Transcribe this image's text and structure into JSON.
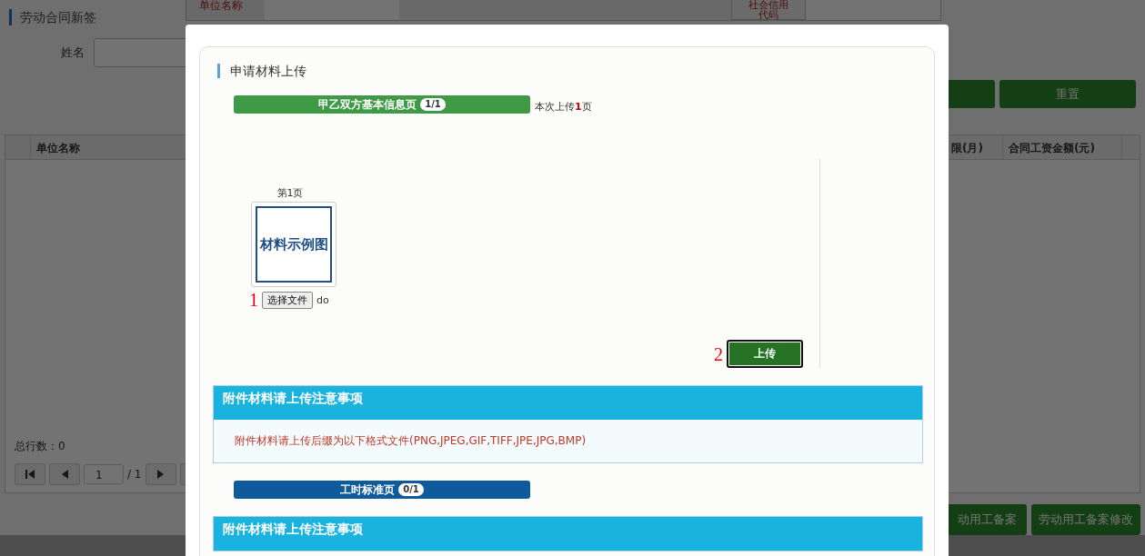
{
  "page": {
    "title": "劳动合同新签",
    "name_label": "姓名",
    "reset_button": "重置",
    "table": {
      "columns": [
        "单位名称",
        "限(月)",
        "合同工资金额(元)"
      ]
    },
    "total_rows": "总行数：0",
    "pager": {
      "page": "1",
      "total": "/ 1"
    },
    "bottom_buttons": [
      "动用工备案",
      "劳动用工备案修改"
    ]
  },
  "back_form": {
    "fields": [
      {
        "label": "单位名称"
      },
      {
        "label": "社会信用代码"
      }
    ]
  },
  "modal": {
    "title": "申请材料上传",
    "groups": [
      {
        "label": "甲乙双方基本信息页",
        "badge": "1/1",
        "color": "#3f9a45",
        "note": {
          "prefix": "本次上传",
          "count": "1",
          "suffix": "页"
        },
        "upload": {
          "page_label": "第1页",
          "example": "材料示例图",
          "step_1": "1",
          "file_button": "选择文件",
          "file_name": "do",
          "step_2": "2",
          "upload_button": "上传"
        },
        "notice": {
          "title": "附件材料请上传注意事项",
          "text": "附件材料请上传后缀为以下格式文件(PNG,JPEG,GIF,TIFF,JPE,JPG,BMP)"
        }
      },
      {
        "label": "工时标准页",
        "badge": "0/1",
        "color": "#0f5a9c",
        "notice": {
          "title": "附件材料请上传注意事项"
        }
      }
    ]
  }
}
